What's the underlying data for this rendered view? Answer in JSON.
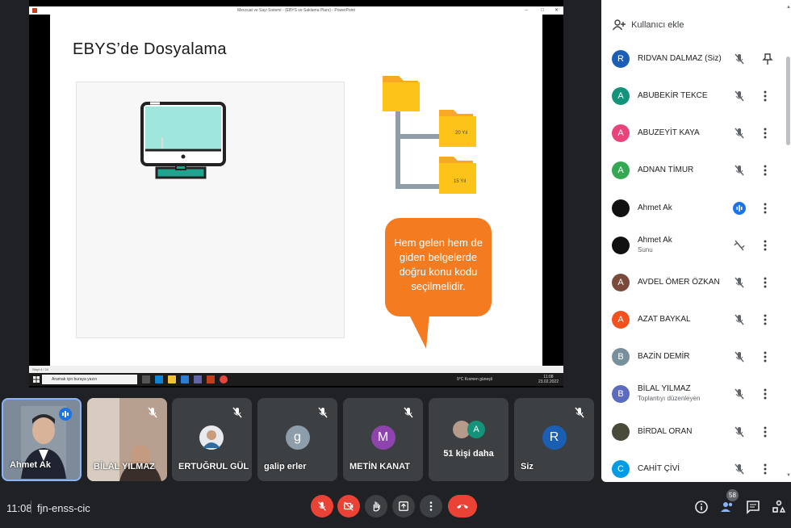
{
  "window": {
    "title": "Mevzuat ve Sayi Sistemi - (EBYS ve Saklama Planı) - PowerPoint",
    "controls": [
      "–",
      "□",
      "✕"
    ]
  },
  "slide": {
    "title": "EBYS’de Dosyalama",
    "folder_labels": [
      "20 Yıl",
      "15 Yıl"
    ],
    "bubble_lines": [
      "Hem gelen hem de",
      "giden belgelerde",
      "doğru konu kodu",
      "seçilmelidir."
    ],
    "status": "Slayt 4 / 24"
  },
  "taskbar": {
    "search_placeholder": "Aramak için buraya yazın",
    "weather": "9°C Kısmen güneşli",
    "time": "11:08",
    "date": "23.02.2022"
  },
  "tiles": [
    {
      "name": "Ahmet Ak"
    },
    {
      "name": "BİLAL YILMAZ"
    },
    {
      "name": "ERTUĞRUL GÜL"
    },
    {
      "name": "galip erler",
      "initial": "g"
    },
    {
      "name": "METİN KANAT",
      "initial": "M"
    },
    {
      "name": "51 kişi daha",
      "initial": "A"
    },
    {
      "name": "Siz",
      "initial": "R"
    }
  ],
  "bottom_bar": {
    "time": "11:08",
    "meeting_code": "fjn-enss-cic",
    "participant_count": "58"
  },
  "panel": {
    "add_user": "Kullanıcı ekle",
    "participants": [
      {
        "initial": "R",
        "name": "RIDVAN DALMAZ (Siz)",
        "color": "#1a5fb4"
      },
      {
        "initial": "A",
        "name": "ABUBEKİR TEKCE",
        "color": "#12937a"
      },
      {
        "initial": "A",
        "name": "ABUZEYİT KAYA",
        "color": "#e8447a"
      },
      {
        "initial": "A",
        "name": "ADNAN TİMUR",
        "color": "#34a853"
      },
      {
        "initial": "",
        "name": "Ahmet Ak",
        "color": "#111111"
      },
      {
        "initial": "",
        "name": "Ahmet Ak",
        "sub": "Sunu",
        "color": "#111111"
      },
      {
        "initial": "A",
        "name": "AVDEL ÖMER ÖZKAN",
        "color": "#7b4a3a"
      },
      {
        "initial": "A",
        "name": "AZAT BAYKAL",
        "color": "#f4511e"
      },
      {
        "initial": "B",
        "name": "BAZİN DEMİR",
        "color": "#78909c"
      },
      {
        "initial": "B",
        "name": "BİLAL YILMAZ",
        "sub": "Toplantıyı düzenleyen",
        "color": "#5c6bc0"
      },
      {
        "initial": "",
        "name": "BİRDAL ORAN",
        "color": "#4a4a3a"
      },
      {
        "initial": "C",
        "name": "CAHİT ÇİVİ",
        "color": "#039be5"
      }
    ]
  },
  "colors": {
    "accent_blue": "#8ab4f8",
    "end_call_red": "#ea4335",
    "bubble_orange": "#f47b20",
    "folder_yellow": "#fcc419",
    "monitor_teal": "#9fe6dd"
  }
}
